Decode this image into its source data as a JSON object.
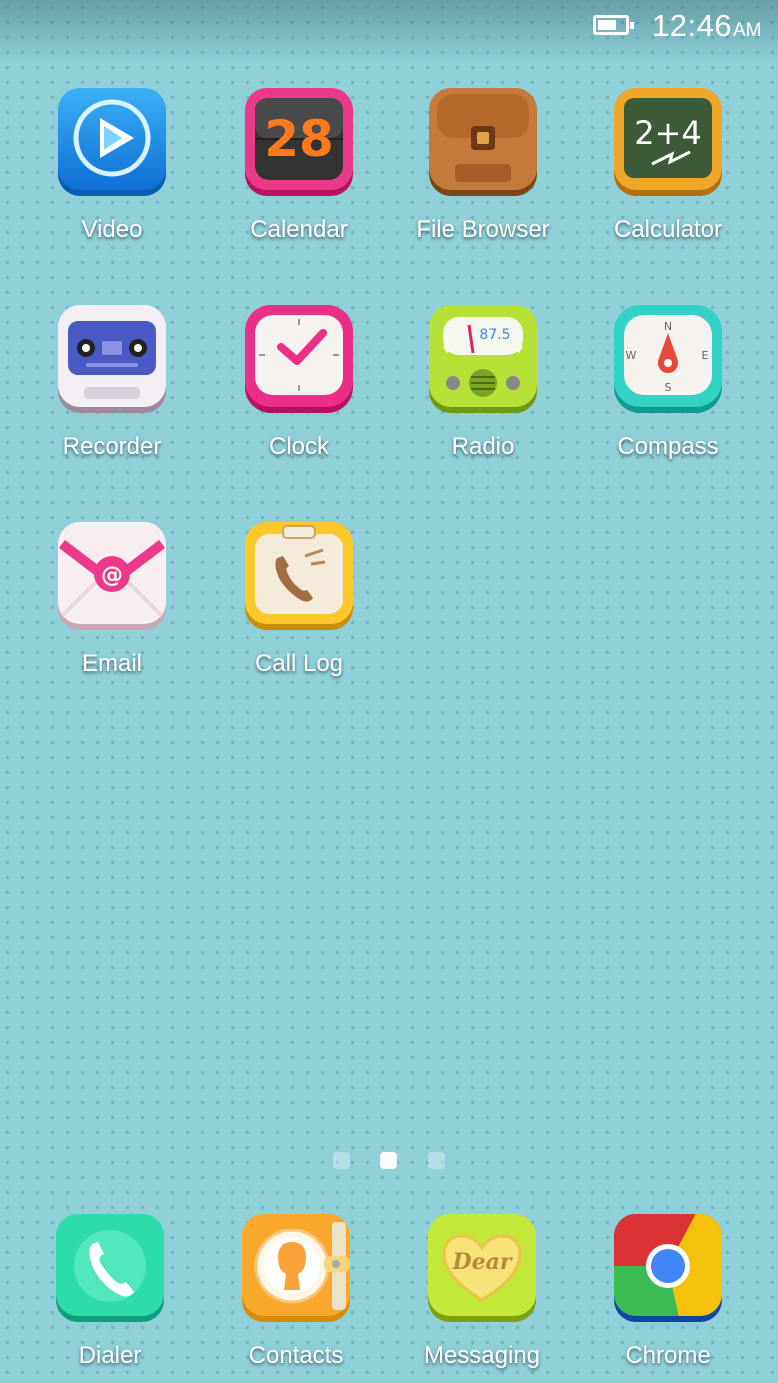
{
  "status_bar": {
    "time": "12:46",
    "ampm": "AM",
    "battery_icon": "battery-icon"
  },
  "apps": [
    {
      "label": "Video",
      "icon": "video-icon"
    },
    {
      "label": "Calendar",
      "icon": "calendar-icon",
      "badge_text": "28"
    },
    {
      "label": "File Browser",
      "icon": "file-browser-icon"
    },
    {
      "label": "Calculator",
      "icon": "calculator-icon",
      "badge_text": "2+4"
    },
    {
      "label": "Recorder",
      "icon": "recorder-icon"
    },
    {
      "label": "Clock",
      "icon": "clock-icon"
    },
    {
      "label": "Radio",
      "icon": "radio-icon",
      "badge_text": "87.5"
    },
    {
      "label": "Compass",
      "icon": "compass-icon",
      "directions": [
        "N",
        "E",
        "S",
        "W"
      ]
    },
    {
      "label": "Email",
      "icon": "email-icon",
      "badge_text": "@"
    },
    {
      "label": "Call Log",
      "icon": "call-log-icon"
    }
  ],
  "page_indicator": {
    "count": 3,
    "active_index": 1
  },
  "dock": [
    {
      "label": "Dialer",
      "icon": "dialer-icon"
    },
    {
      "label": "Contacts",
      "icon": "contacts-icon"
    },
    {
      "label": "Messaging",
      "icon": "messaging-icon",
      "badge_text": "Dear"
    },
    {
      "label": "Chrome",
      "icon": "chrome-icon"
    }
  ],
  "colors": {
    "background": "#8ecfd8",
    "label_text": "#ffffff"
  }
}
